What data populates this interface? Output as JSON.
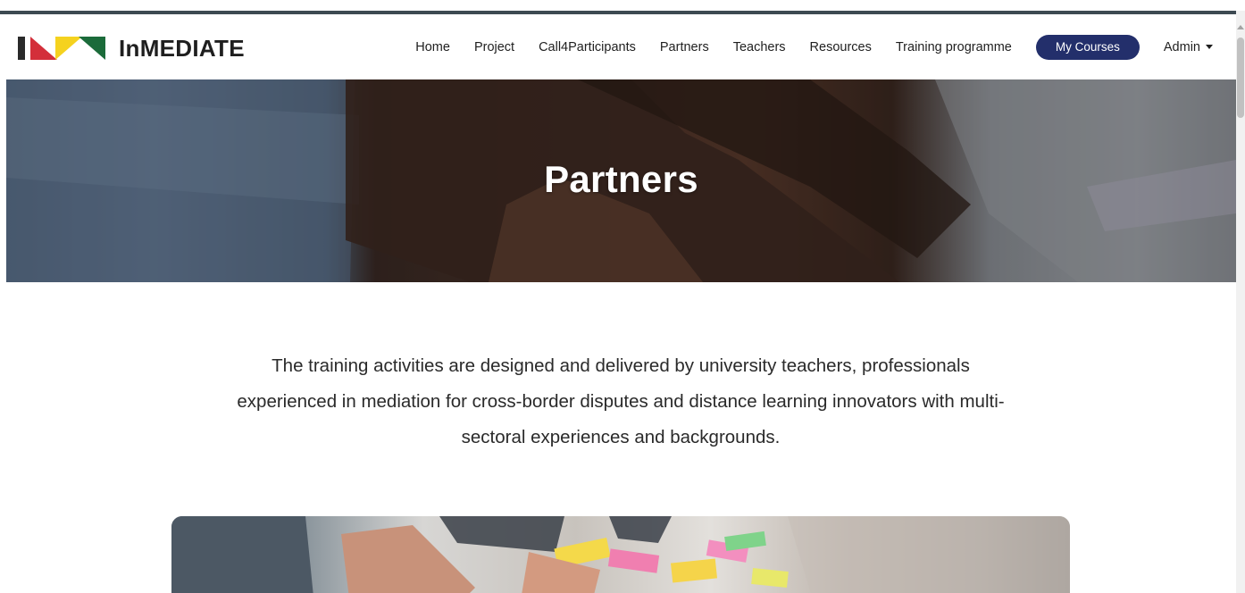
{
  "brand": {
    "name": "InMEDIATE",
    "logo_colors": [
      "#d32f3a",
      "#f5d21f",
      "#1b6b3a"
    ]
  },
  "nav": {
    "items": [
      {
        "label": "Home"
      },
      {
        "label": "Project"
      },
      {
        "label": "Call4Participants"
      },
      {
        "label": "Partners"
      },
      {
        "label": "Teachers"
      },
      {
        "label": "Resources"
      },
      {
        "label": "Training programme"
      }
    ],
    "my_courses": "My Courses",
    "admin": "Admin"
  },
  "hero": {
    "title": "Partners"
  },
  "intro": {
    "text": "The training activities are designed and delivered by university teachers, professionals experienced in mediation for cross-border disputes and distance learning innovators with multi-sectoral experiences and backgrounds."
  },
  "colors": {
    "accent": "#232f6b",
    "top_border": "#3d4a52"
  }
}
